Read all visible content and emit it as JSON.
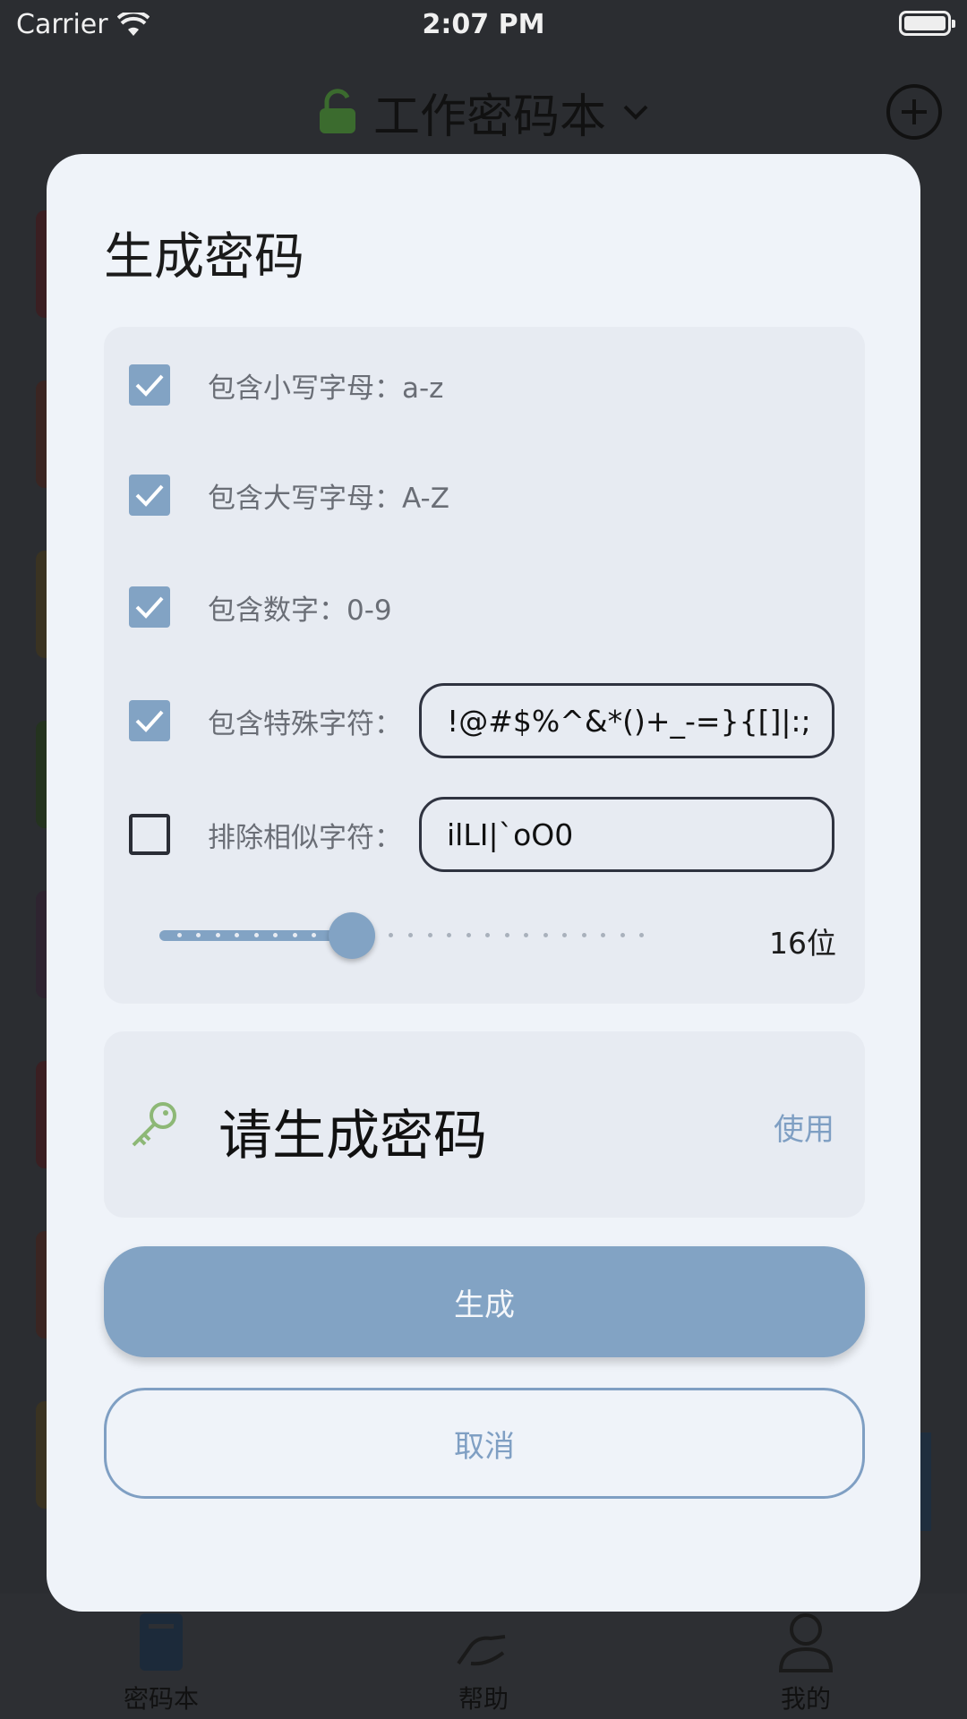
{
  "status_bar": {
    "carrier": "Carrier",
    "time": "2:07 PM"
  },
  "header": {
    "notebook_title": "工作密码本",
    "lock_icon": "unlocked-padlock-icon",
    "dropdown_icon": "chevron-down-icon",
    "add_icon": "circle-plus-icon"
  },
  "modal": {
    "title": "生成密码",
    "options": [
      {
        "label": "包含小写字母：a-z",
        "checked": true
      },
      {
        "label": "包含大写字母：A-Z",
        "checked": true
      },
      {
        "label": "包含数字：0-9",
        "checked": true
      },
      {
        "label": "包含特殊字符：",
        "checked": true,
        "value": "!@#$%^&*()+_-=}{[]|:;"
      },
      {
        "label": "排除相似字符：",
        "checked": false,
        "value": "ilLI|`oO0"
      }
    ],
    "length_slider": {
      "value": 16,
      "min": 6,
      "max": 32,
      "label": "16位"
    },
    "result": {
      "placeholder": "请生成密码",
      "use_label": "使用",
      "icon": "key-icon"
    },
    "generate_label": "生成",
    "cancel_label": "取消"
  },
  "tab_bar": {
    "items": [
      {
        "label": "密码本",
        "icon": "book-icon"
      },
      {
        "label": "帮助",
        "icon": "help-hand-icon"
      },
      {
        "label": "我的",
        "icon": "user-icon"
      }
    ]
  },
  "colors": {
    "accent": "#82a3c4",
    "modal_bg": "#eff3f9",
    "panel_bg": "#e7ebf2",
    "lock_green": "#3b6b2e",
    "key_green": "#8db876"
  }
}
